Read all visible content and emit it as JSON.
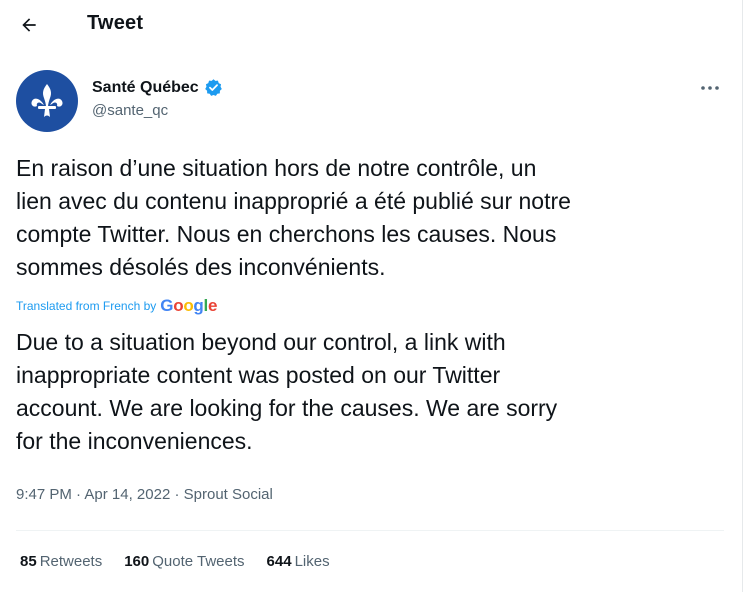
{
  "header": {
    "title": "Tweet",
    "back_icon": "arrow-left-icon"
  },
  "author": {
    "name": "Santé Québec",
    "handle": "@sante_qc",
    "verified": true,
    "avatar_icon": "fleur-de-lis-icon",
    "avatar_color": "#1e4fa1"
  },
  "tweet": {
    "original_text": "En raison d’une situation hors de notre contrôle, un\nlien avec du contenu inapproprié a été publié sur notre\ncompte Twitter. Nous en cherchons les causes. Nous\nsommes désolés des inconvénients.",
    "translation_label": "Translated from French by",
    "translation_provider": "Google",
    "translated_text": "Due to a situation beyond our control, a link with\ninappropriate content was posted on our Twitter\naccount. We are looking for the causes. We are sorry\nfor the inconveniences.",
    "time": "9:47 PM",
    "separator": "·",
    "date": "Apr 14, 2022",
    "source": "Sprout Social"
  },
  "stats": {
    "retweets_count": "85",
    "retweets_label": "Retweets",
    "quotes_count": "160",
    "quotes_label": "Quote Tweets",
    "likes_count": "644",
    "likes_label": "Likes"
  },
  "colors": {
    "accent": "#1d9bf0",
    "text": "#0f1419",
    "secondary_text": "#536471",
    "divider": "#eff3f4"
  },
  "icons": {
    "more": "more-horizontal-icon",
    "verified": "verified-badge-icon"
  }
}
